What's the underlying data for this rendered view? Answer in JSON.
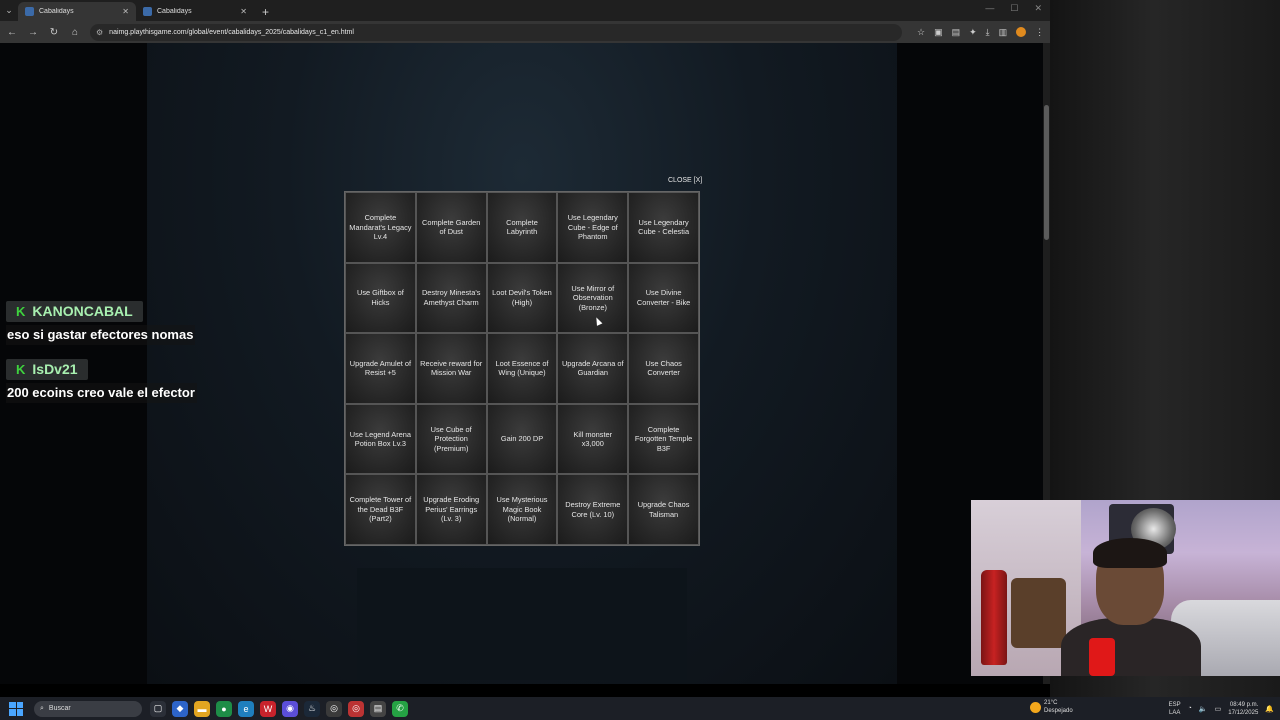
{
  "browser": {
    "tabs": [
      {
        "label": "Cabalidays",
        "active": true
      },
      {
        "label": "Cabalidays",
        "active": false
      }
    ],
    "new_tab": "+",
    "url": "naimg.playthisgame.com/global/event/cabalidays_2025/cabalidays_c1_en.html"
  },
  "modal": {
    "close_label": "CLOSE [X]",
    "cells": [
      "Complete Mandarat's Legacy Lv.4",
      "Complete Garden of Dust",
      "Complete Labyrinth",
      "Use Legendary Cube - Edge of Phantom",
      "Use Legendary Cube - Celestia",
      "Use Giftbox of Hicks",
      "Destroy Minesta's Amethyst Charm",
      "Loot Devil's Token (High)",
      "Use Mirror of Observation (Bronze)",
      "Use Divine Converter - Bike",
      "Upgrade Amulet of Resist +5",
      "Receive reward for Mission War",
      "Loot Essence of Wing (Unique)",
      "Upgrade Arcana of Guardian",
      "Use Chaos Converter",
      "Use Legend Arena Potion Box Lv.3",
      "Use Cube of Protection (Premium)",
      "Gain 200 DP",
      "Kill monster x3,000",
      "Complete Forgotten Temple B3F",
      "Complete Tower of the Dead B3F (Part2)",
      "Upgrade Eroding Perius' Earrings (Lv. 3)",
      "Use Mysterious Magic Book (Normal)",
      "Destroy Extreme Core (Lv. 10)",
      "Upgrade Chaos Talisman"
    ]
  },
  "chat": [
    {
      "badge": "K",
      "user": "KANONCABAL",
      "message": "eso si gastar efectores nomas"
    },
    {
      "badge": "K",
      "user": "IsDv21",
      "message": "200 ecoins creo vale el efector"
    }
  ],
  "taskbar": {
    "search_placeholder": "Buscar",
    "weather_temp": "21°C",
    "weather_desc": "Despejado",
    "lang_1": "ESP",
    "lang_2": "LAA",
    "time": "08:49 p.m.",
    "date": "17/12/2025"
  },
  "colors": {
    "chat_name": "#a8f0b0",
    "chat_badge": "#3ed33e",
    "modal_cell_bg": "#2e2e2e"
  }
}
